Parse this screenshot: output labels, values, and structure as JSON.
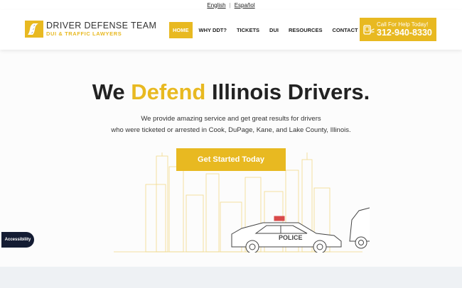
{
  "lang": {
    "english": "English",
    "espanol": "Español"
  },
  "logo": {
    "title": "DRIVER DEFENSE TEAM",
    "subtitle": "DUI & TRAFFIC LAWYERS"
  },
  "nav": {
    "items": [
      "HOME",
      "WHY DDT?",
      "TICKETS",
      "DUI",
      "RESOURCES",
      "CONTACT"
    ]
  },
  "call": {
    "label": "Call For Help Today!",
    "phone": "312-940-8330"
  },
  "hero": {
    "title_pre": "We",
    "title_accent": "Defend",
    "title_post": "Illinois Drivers.",
    "line1": "We provide amazing service and get great results for drivers",
    "line2": "who were ticketed or arrested in Cook, DuPage, Kane, and Lake County, Illinois.",
    "cta": "Get Started Today",
    "car_label": "POLICE"
  },
  "accessibility": {
    "label": "Accessibility"
  },
  "colors": {
    "accent": "#e8b921",
    "dark": "#222222",
    "accessibility_bg": "#141c33"
  }
}
